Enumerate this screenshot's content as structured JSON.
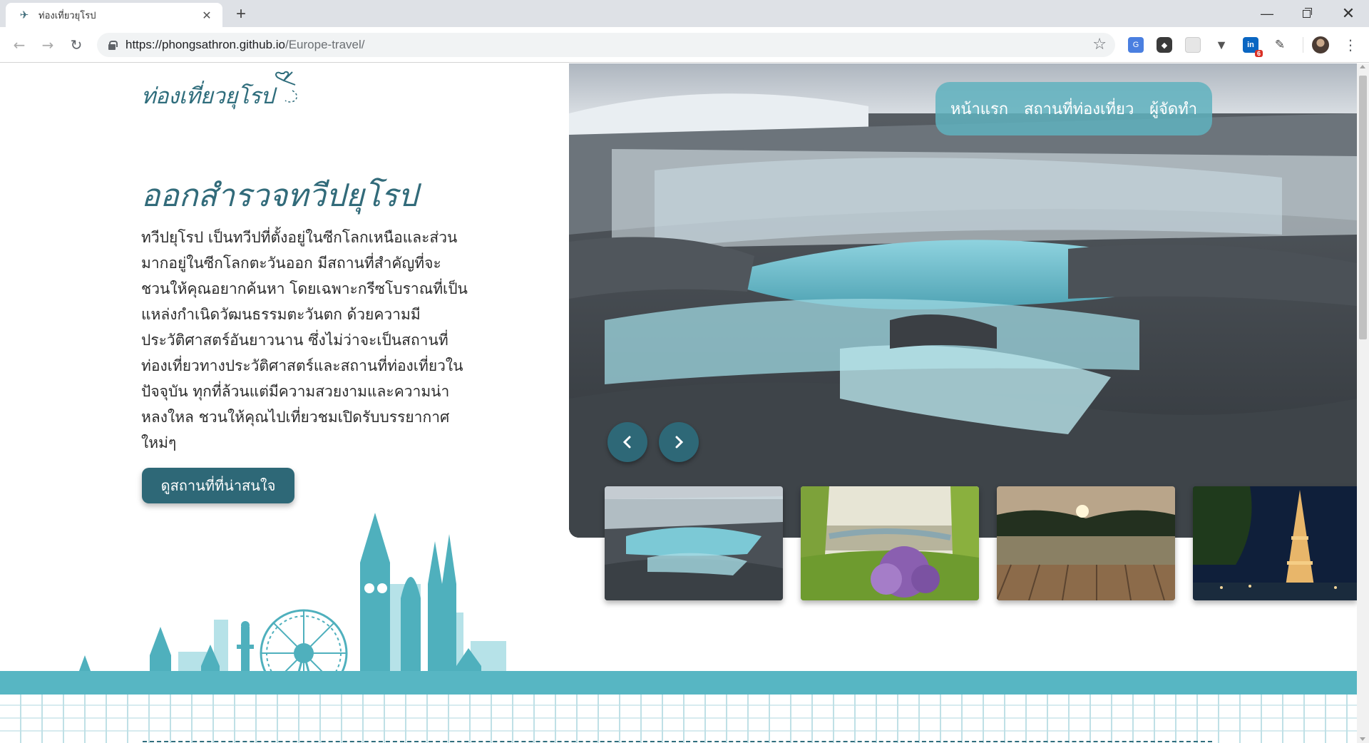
{
  "browser": {
    "tab_title": "ท่องเที่ยวยุโรป",
    "url_host": "https://phongsathron.github.io",
    "url_path": "/Europe-travel/",
    "linkedin_badge": "6",
    "icons": [
      "back-icon",
      "forward-icon",
      "reload-icon",
      "lock-icon",
      "star-icon",
      "translate-icon",
      "shield-icon",
      "linkedin-icon",
      "eyedropper-icon",
      "menu-icon"
    ]
  },
  "site": {
    "logo": "ท่องเที่ยวยุโรป",
    "nav": [
      "หน้าแรก",
      "สถานที่ท่องเที่ยว",
      "ผู้จัดทำ"
    ],
    "headline": "ออกสำรวจทวีปยุโรป",
    "body": "ทวีปยุโรป เป็นทวีปที่ตั้งอยู่ในซีกโลกเหนือและส่วนมากอยู่ในซีกโลกตะวันออก มีสถานที่สำคัญที่จะชวนให้คุณอยากค้นหา โดยเฉพาะกรีซโบราณที่เป็นแหล่งกำเนิดวัฒนธรรมตะวันตก ด้วยความมีประวัติศาสตร์อันยาวนาน ซึ่งไม่ว่าจะเป็นสถานที่ท่องเที่ยวทางประวัติศาสตร์และสถานที่ท่องเที่ยวในปัจจุบัน ทุกที่ล้วนแต่มีความสวยงามและความน่าหลงใหล ชวนให้คุณไปเที่ยวชมเปิดรับบรรยากาศใหม่ๆ",
    "cta": "ดูสถานที่ที่น่าสนใจ"
  },
  "colors": {
    "primary": "#2e6877",
    "accent": "#57b6c3",
    "menu_bg": "#5fb2be",
    "skyline_dark": "#4fb0bd",
    "skyline_light": "#b6e2e8"
  },
  "carousel": {
    "thumbnails": [
      "waterfall",
      "city-river-flowers",
      "lake-sunset-dock",
      "eiffel-tower-night"
    ]
  }
}
